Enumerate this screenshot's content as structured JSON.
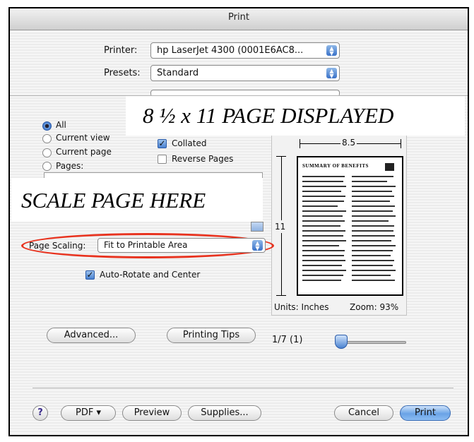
{
  "window": {
    "title": "Print"
  },
  "printer": {
    "label": "Printer:",
    "value": "hp LaserJet 4300 (0001E6AC8..."
  },
  "presets": {
    "label": "Presets:",
    "value": "Standard"
  },
  "range": {
    "options": [
      "All",
      "Current view",
      "Current page",
      "Pages:"
    ],
    "selected": "All"
  },
  "copies": {
    "collated_label": "Collated",
    "collated_checked": true,
    "reverse_label": "Reverse Pages",
    "reverse_checked": false
  },
  "scaling": {
    "label": "Page Scaling:",
    "value": "Fit to Printable Area"
  },
  "auto_rotate": {
    "label": "Auto-Rotate and Center",
    "checked": true
  },
  "preview": {
    "width_label": "8.5",
    "height_label": "11",
    "units": "Units: Inches",
    "zoom": "Zoom: 93%",
    "page_indicator": "1/7 (1)",
    "doc_title": "SUMMARY OF BENEFITS"
  },
  "buttons": {
    "advanced": "Advanced...",
    "printing_tips": "Printing Tips",
    "help": "?",
    "pdf": "PDF ▾",
    "preview": "Preview",
    "supplies": "Supplies...",
    "cancel": "Cancel",
    "print": "Print"
  },
  "annotations": {
    "page_displayed": "8 ½ x 11 PAGE DISPLAYED",
    "scale_here": "SCALE PAGE HERE"
  },
  "colors": {
    "highlight_ellipse": "#e8321e",
    "default_button": "#6aa3e6"
  }
}
